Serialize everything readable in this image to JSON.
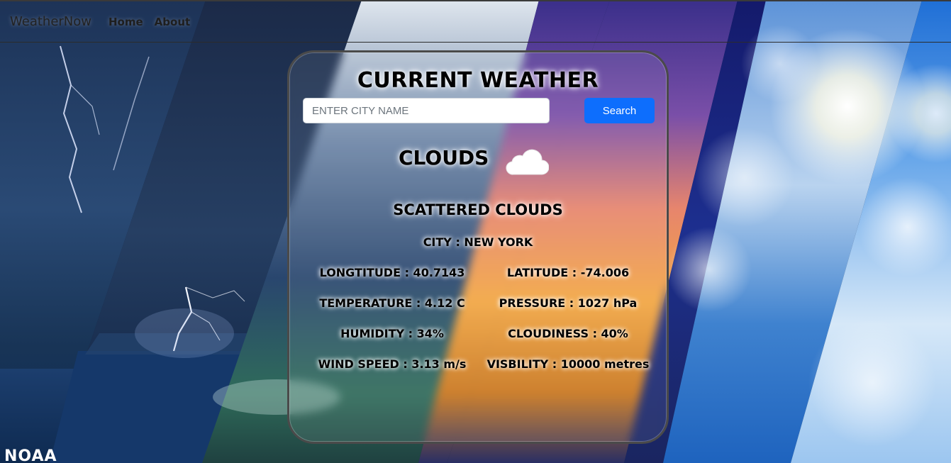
{
  "navbar": {
    "brand": "WeatherNow",
    "links": [
      "Home",
      "About"
    ]
  },
  "card": {
    "title": "CURRENT WEATHER",
    "search": {
      "placeholder": "ENTER CITY NAME",
      "button_label": "Search"
    },
    "condition_main": "CLOUDS",
    "condition_icon": "cloud-icon",
    "condition_description": "SCATTERED CLOUDS",
    "city": "CITY : NEW YORK",
    "details": {
      "longitude": "LONGTITUDE : 40.7143",
      "latitude": "LATITUDE : -74.006",
      "temperature": "TEMPERATURE : 4.12 C",
      "pressure": "PRESSURE : 1027 hPa",
      "humidity": "HUMIDITY : 34%",
      "cloudiness": "CLOUDINESS : 40%",
      "wind_speed": "WIND SPEED : 3.13 m/s",
      "visibility": "VISBILITY : 10000 metres"
    }
  },
  "watermark": "NOAA",
  "colors": {
    "button": "#0d6efd",
    "card_border": "#4a4a4a"
  }
}
